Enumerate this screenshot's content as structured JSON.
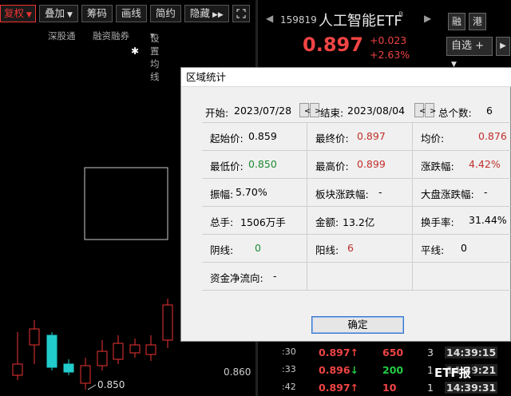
{
  "toolbar": {
    "fuquan": "复权",
    "diejia": "叠加",
    "choumа": "筹码",
    "huaxian": "画线",
    "jianyue": "简约",
    "yincang": "隐藏"
  },
  "subbar": {
    "shengutong": "深股通",
    "rongzi": "融资融券",
    "junxian": "设置均线"
  },
  "chart": {
    "low_label": "0.850",
    "axis_label": "0.860",
    "marker": "✱"
  },
  "stock": {
    "code": "159819",
    "name": "人工智能ETF",
    "flag": "B",
    "price": "0.897",
    "change": "+0.023",
    "change_pct": "+2.63%",
    "tag1": "融",
    "tag2": "港",
    "watch": "自选"
  },
  "ticks": [
    {
      "idx": ":30",
      "price": "0.897",
      "dir": "up",
      "vol": "650",
      "num": "3",
      "time": "14:39:15"
    },
    {
      "idx": ":33",
      "price": "0.896",
      "dir": "down",
      "vol": "200",
      "num": "1",
      "time": "14:39:21"
    },
    {
      "idx": ":42",
      "price": "0.897",
      "dir": "up",
      "vol": "10",
      "num": "1",
      "time": "14:39:31"
    }
  ],
  "watermark": "ETF报",
  "dialog": {
    "title": "区域统计",
    "start_label": "开始:",
    "start_date": "2023/07/28",
    "end_label": "结束:",
    "end_date": "2023/08/04",
    "count_label": "总个数:",
    "count": "6",
    "rows": [
      [
        {
          "label": "起始价:",
          "value": "0.859",
          "color": "black"
        },
        {
          "label": "最终价:",
          "value": "0.897",
          "color": "red"
        },
        {
          "label": "均价:",
          "value": "0.876",
          "color": "red"
        }
      ],
      [
        {
          "label": "最低价:",
          "value": "0.850",
          "color": "green"
        },
        {
          "label": "最高价:",
          "value": "0.899",
          "color": "red"
        },
        {
          "label": "涨跌幅:",
          "value": "4.42%",
          "color": "red"
        }
      ],
      [
        {
          "label": "振幅:",
          "value": "5.70%",
          "color": "black"
        },
        {
          "label": "板块涨跌幅:",
          "value": "-",
          "color": "black"
        },
        {
          "label": "大盘涨跌幅:",
          "value": "-",
          "color": "black"
        }
      ],
      [
        {
          "label": "总手:",
          "value": "1506万手",
          "color": "black"
        },
        {
          "label": "金额:",
          "value": "13.2亿",
          "color": "black"
        },
        {
          "label": "换手率:",
          "value": "31.44%",
          "color": "black"
        }
      ],
      [
        {
          "label": "阴线:",
          "value": "0",
          "color": "green"
        },
        {
          "label": "阳线:",
          "value": "6",
          "color": "red"
        },
        {
          "label": "平线:",
          "value": "0",
          "color": "black"
        }
      ],
      [
        {
          "label": "资金净流向:",
          "value": "-",
          "color": "black"
        },
        {
          "label": "",
          "value": "",
          "color": "black"
        },
        {
          "label": "",
          "value": "",
          "color": "black"
        }
      ]
    ],
    "ok": "确定"
  }
}
